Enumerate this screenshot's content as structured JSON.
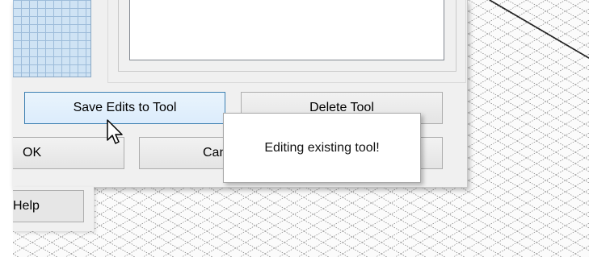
{
  "dialog": {
    "buttons": {
      "save_edits": "Save Edits to Tool",
      "delete_tool": "Delete Tool",
      "ok": "OK",
      "cancel": "Cancel",
      "help": "Help"
    }
  },
  "tooltip": {
    "text": "Editing existing tool!"
  },
  "icons": {
    "cursor": "arrow-pointer-icon"
  },
  "colors": {
    "focus_border": "#3c7fb1",
    "dialog_bg": "#f0f0f0",
    "grid_preview_bg": "#cfe3f4"
  }
}
